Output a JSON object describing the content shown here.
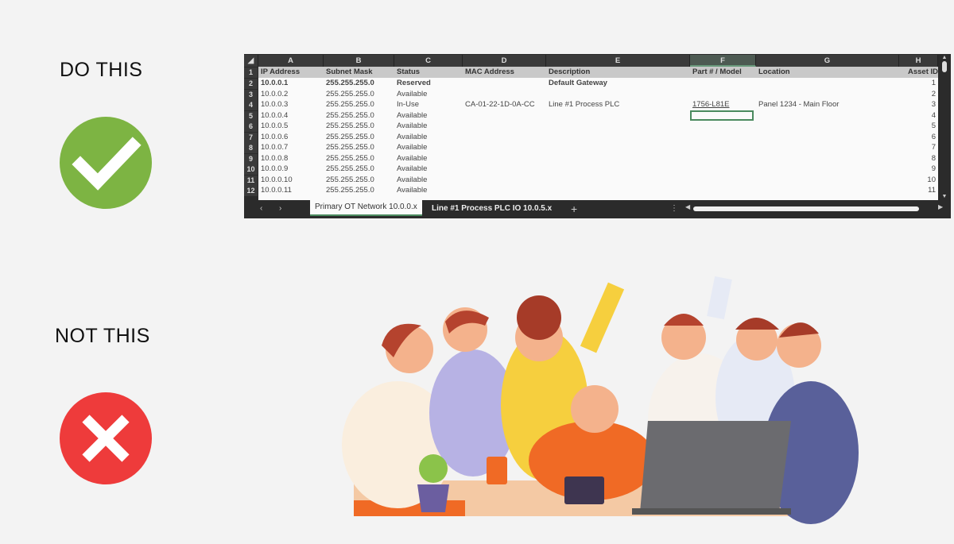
{
  "labels": {
    "do_this": "DO THIS",
    "not_this": "NOT THIS"
  },
  "icons": {
    "do": "check-icon",
    "dont": "x-icon"
  },
  "colors": {
    "check": "#7db443",
    "cross": "#ee3b3b",
    "selected_cell": "#4a8a5e"
  },
  "sheet": {
    "columns": [
      "A",
      "B",
      "C",
      "D",
      "E",
      "F",
      "G",
      "H"
    ],
    "headers": [
      "IP Address",
      "Subnet Mask",
      "Status",
      "MAC Address",
      "Description",
      "Part # / Model",
      "Location",
      "Asset ID"
    ],
    "rows": [
      {
        "n": "2",
        "ip": "10.0.0.1",
        "mask": "255.255.255.0",
        "status": "Reserved",
        "mac": "",
        "desc": "Default Gateway",
        "part": "",
        "loc": "",
        "asset": "1"
      },
      {
        "n": "3",
        "ip": "10.0.0.2",
        "mask": "255.255.255.0",
        "status": "Available",
        "mac": "",
        "desc": "",
        "part": "",
        "loc": "",
        "asset": "2"
      },
      {
        "n": "4",
        "ip": "10.0.0.3",
        "mask": "255.255.255.0",
        "status": "In-Use",
        "mac": "CA-01-22-1D-0A-CC",
        "desc": "Line #1 Process PLC",
        "part": "1756-L81E",
        "loc": "Panel 1234 - Main Floor",
        "asset": "3"
      },
      {
        "n": "5",
        "ip": "10.0.0.4",
        "mask": "255.255.255.0",
        "status": "Available",
        "mac": "",
        "desc": "",
        "part": "",
        "loc": "",
        "asset": "4"
      },
      {
        "n": "6",
        "ip": "10.0.0.5",
        "mask": "255.255.255.0",
        "status": "Available",
        "mac": "",
        "desc": "",
        "part": "",
        "loc": "",
        "asset": "5"
      },
      {
        "n": "7",
        "ip": "10.0.0.6",
        "mask": "255.255.255.0",
        "status": "Available",
        "mac": "",
        "desc": "",
        "part": "",
        "loc": "",
        "asset": "6"
      },
      {
        "n": "8",
        "ip": "10.0.0.7",
        "mask": "255.255.255.0",
        "status": "Available",
        "mac": "",
        "desc": "",
        "part": "",
        "loc": "",
        "asset": "7"
      },
      {
        "n": "9",
        "ip": "10.0.0.8",
        "mask": "255.255.255.0",
        "status": "Available",
        "mac": "",
        "desc": "",
        "part": "",
        "loc": "",
        "asset": "8"
      },
      {
        "n": "10",
        "ip": "10.0.0.9",
        "mask": "255.255.255.0",
        "status": "Available",
        "mac": "",
        "desc": "",
        "part": "",
        "loc": "",
        "asset": "9"
      },
      {
        "n": "11",
        "ip": "10.0.0.10",
        "mask": "255.255.255.0",
        "status": "Available",
        "mac": "",
        "desc": "",
        "part": "",
        "loc": "",
        "asset": "10"
      },
      {
        "n": "12",
        "ip": "10.0.0.11",
        "mask": "255.255.255.0",
        "status": "Available",
        "mac": "",
        "desc": "",
        "part": "",
        "loc": "",
        "asset": "11"
      }
    ],
    "tabs": [
      "Primary OT Network 10.0.0.x",
      "Line #1 Process PLC IO 10.0.5.x"
    ],
    "active_tab": "Primary OT Network 10.0.0.x",
    "add_sheet": "+"
  }
}
